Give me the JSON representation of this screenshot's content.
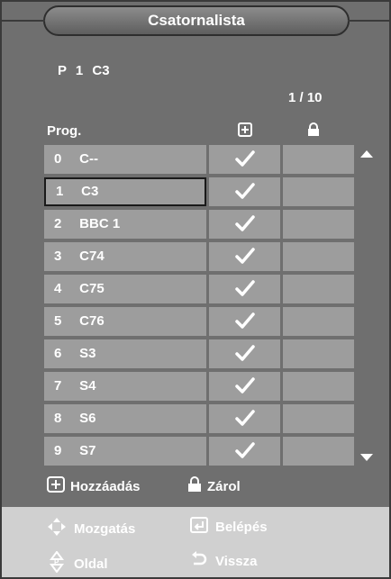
{
  "header": {
    "title": "Csatornalista"
  },
  "info": {
    "program": "P",
    "number": "1",
    "channel": "C3",
    "page": "1 / 10"
  },
  "columns": {
    "prog": "Prog."
  },
  "rows": [
    {
      "num": "0",
      "name": "C--",
      "added": true,
      "locked": false,
      "selected": false
    },
    {
      "num": "1",
      "name": "C3",
      "added": true,
      "locked": false,
      "selected": true
    },
    {
      "num": "2",
      "name": "BBC 1",
      "added": true,
      "locked": false,
      "selected": false
    },
    {
      "num": "3",
      "name": "C74",
      "added": true,
      "locked": false,
      "selected": false
    },
    {
      "num": "4",
      "name": "C75",
      "added": true,
      "locked": false,
      "selected": false
    },
    {
      "num": "5",
      "name": "C76",
      "added": true,
      "locked": false,
      "selected": false
    },
    {
      "num": "6",
      "name": "S3",
      "added": true,
      "locked": false,
      "selected": false
    },
    {
      "num": "7",
      "name": "S4",
      "added": true,
      "locked": false,
      "selected": false
    },
    {
      "num": "8",
      "name": "S6",
      "added": true,
      "locked": false,
      "selected": false
    },
    {
      "num": "9",
      "name": "S7",
      "added": true,
      "locked": false,
      "selected": false
    }
  ],
  "legend": {
    "add": "Hozzáadás",
    "lock": "Zárol"
  },
  "hints": {
    "move": "Mozgatás",
    "enter": "Belépés",
    "page": "Oldal",
    "return": "Vissza"
  },
  "icons": {
    "add": "plus-box-icon",
    "lock": "padlock-icon",
    "check": "checkmark-icon",
    "move": "four-way-arrows-icon",
    "enter": "enter-icon",
    "page": "up-down-icon",
    "return": "return-arrow-icon"
  },
  "colors": {
    "background": "#6f6f6f",
    "cell": "#9d9d9d",
    "bottom_bar": "#d0d0d0",
    "text": "#ffffff"
  }
}
